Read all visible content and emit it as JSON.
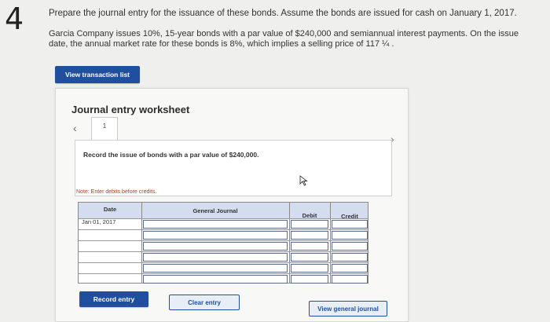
{
  "question": {
    "number": "4",
    "prompt": "Prepare the journal entry for the issuance of these bonds. Assume the bonds are issued for cash on January 1, 2017.",
    "problem": "Garcia Company issues 10%, 15-year bonds with a par value of $240,000 and semiannual interest payments. On the issue date, the annual market rate for these bonds is 8%, which implies a selling price of 117 ¼ ."
  },
  "toolbar": {
    "view_transaction_list": "View transaction list"
  },
  "worksheet": {
    "title": "Journal entry worksheet",
    "nav_prev_icon": "chevron-left-icon",
    "nav_next_icon": "chevron-right-icon",
    "active_tab": "1",
    "instruction": "Record the issue of bonds with a par value of $240,000.",
    "note": "Note: Enter debits before credits.",
    "table": {
      "headers": [
        "Date",
        "General Journal",
        "Debit",
        "Credit"
      ],
      "rows": [
        {
          "date": "Jan 01, 2017",
          "account": "",
          "debit": "",
          "credit": ""
        },
        {
          "date": "",
          "account": "",
          "debit": "",
          "credit": ""
        },
        {
          "date": "",
          "account": "",
          "debit": "",
          "credit": ""
        },
        {
          "date": "",
          "account": "",
          "debit": "",
          "credit": ""
        },
        {
          "date": "",
          "account": "",
          "debit": "",
          "credit": ""
        },
        {
          "date": "",
          "account": "",
          "debit": "",
          "credit": ""
        }
      ]
    },
    "buttons": {
      "record_entry": "Record entry",
      "clear_entry": "Clear entry",
      "view_general_journal": "View general journal"
    }
  },
  "colors": {
    "primary": "#1f4f9e",
    "table_header": "#d4dcef",
    "note": "#b04020"
  }
}
